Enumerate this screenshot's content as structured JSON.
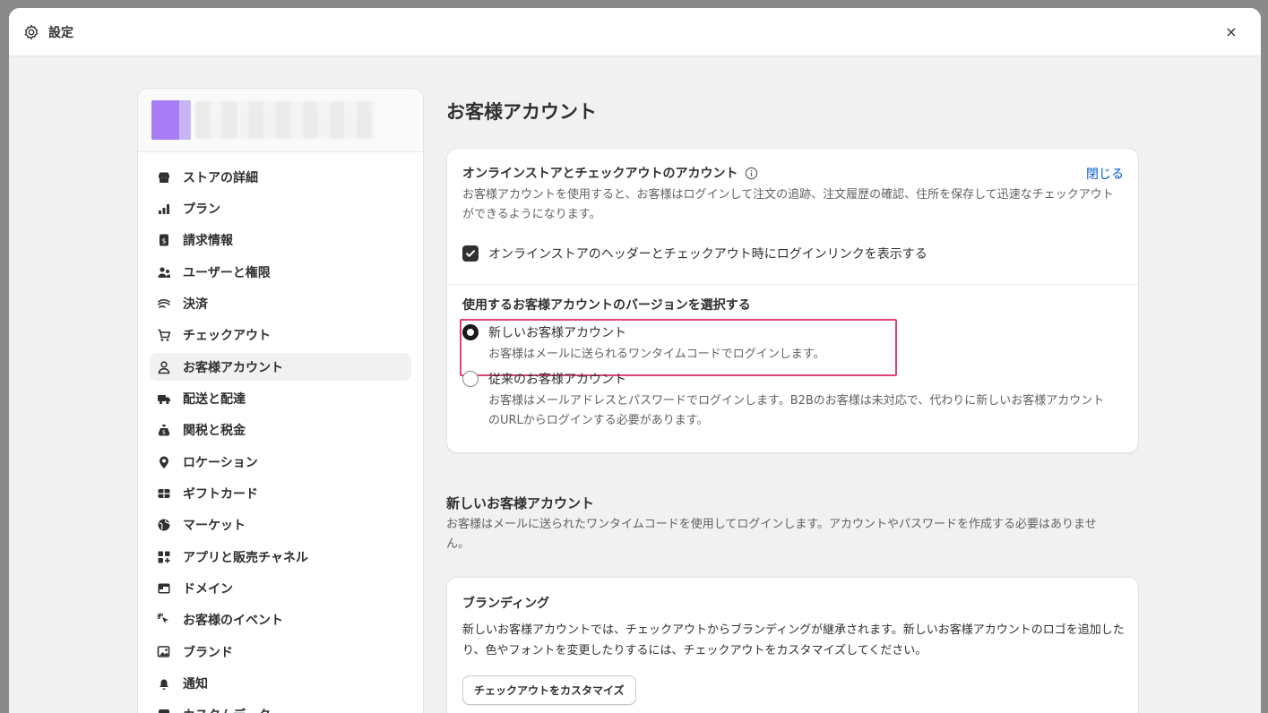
{
  "window": {
    "title": "設定",
    "close_glyph": "×"
  },
  "sidebar": {
    "items": [
      {
        "label": "ストアの詳細",
        "icon": "store-icon"
      },
      {
        "label": "プラン",
        "icon": "chart-icon"
      },
      {
        "label": "請求情報",
        "icon": "bill-icon"
      },
      {
        "label": "ユーザーと権限",
        "icon": "users-icon"
      },
      {
        "label": "決済",
        "icon": "payment-icon"
      },
      {
        "label": "チェックアウト",
        "icon": "cart-icon"
      },
      {
        "label": "お客様アカウント",
        "icon": "person-icon",
        "active": true
      },
      {
        "label": "配送と配達",
        "icon": "truck-icon"
      },
      {
        "label": "関税と税金",
        "icon": "money-bag-icon"
      },
      {
        "label": "ロケーション",
        "icon": "location-icon"
      },
      {
        "label": "ギフトカード",
        "icon": "gift-card-icon"
      },
      {
        "label": "マーケット",
        "icon": "globe-icon"
      },
      {
        "label": "アプリと販売チャネル",
        "icon": "apps-icon"
      },
      {
        "label": "ドメイン",
        "icon": "domain-icon"
      },
      {
        "label": "お客様のイベント",
        "icon": "cursor-icon"
      },
      {
        "label": "ブランド",
        "icon": "brand-icon"
      },
      {
        "label": "通知",
        "icon": "bell-icon"
      },
      {
        "label": "カスタムデータ",
        "icon": "data-icon"
      }
    ]
  },
  "main": {
    "page_title": "お客様アカウント",
    "accounts_card": {
      "title": "オンラインストアとチェックアウトのアカウント",
      "close_link": "閉じる",
      "description": "お客様アカウントを使用すると、お客様はログインして注文の追跡、注文履歴の確認、住所を保存して迅速なチェックアウトができるようになります。",
      "checkbox_label": "オンラインストアのヘッダーとチェックアウト時にログインリンクを表示する",
      "version_heading": "使用するお客様アカウントのバージョンを選択する",
      "option_new_label": "新しいお客様アカウント",
      "option_new_help": "お客様はメールに送られるワンタイムコードでログインします。",
      "option_legacy_label": "従来のお客様アカウント",
      "option_legacy_help": "お客様はメールアドレスとパスワードでログインします。B2Bのお客様は未対応で、代わりに新しいお客様アカウントのURLからログインする必要があります。"
    },
    "new_accounts_section": {
      "title": "新しいお客様アカウント",
      "description": "お客様はメールに送られたワンタイムコードを使用してログインします。アカウントやパスワードを作成する必要はありません。"
    },
    "branding_card": {
      "title": "ブランディング",
      "description": "新しいお客様アカウントでは、チェックアウトからブランディングが継承されます。新しいお客様アカウントのロゴを追加したり、色やフォントを変更したりするには、チェックアウトをカスタマイズしてください。",
      "button_label": "チェックアウトをカスタマイズ"
    }
  }
}
